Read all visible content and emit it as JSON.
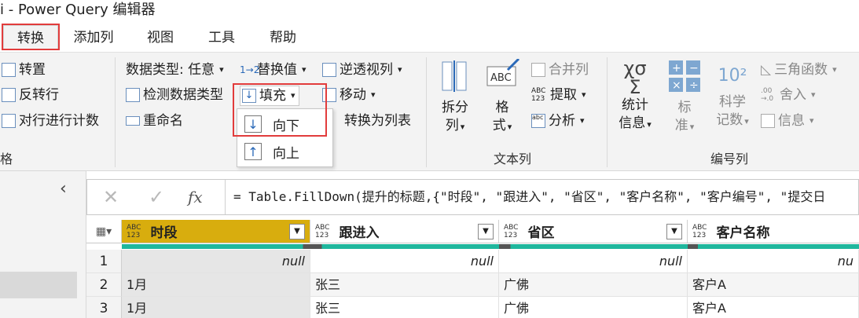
{
  "window": {
    "title": "i - Power Query 编辑器"
  },
  "tabs": [
    {
      "label": "转换",
      "active": true
    },
    {
      "label": "添加列"
    },
    {
      "label": "视图"
    },
    {
      "label": "工具"
    },
    {
      "label": "帮助"
    }
  ],
  "ribbon": {
    "table_group": {
      "transpose": "转置",
      "reverse_rows": "反转行",
      "count_rows": "对行进行计数",
      "label": "格"
    },
    "any_col_group": {
      "data_type": "数据类型: 任意",
      "detect_type": "检测数据类型",
      "rename": "重命名",
      "replace_values": "替换值",
      "fill": "填充",
      "unpivot": "逆透视列",
      "move": "移动",
      "convert_to_list": "转换为列表"
    },
    "text_group": {
      "split_column": [
        "拆分",
        "列"
      ],
      "format": [
        "格",
        "式"
      ],
      "merge_columns": "合并列",
      "extract": "提取",
      "parse": "分析",
      "label": "文本列"
    },
    "number_group": {
      "statistics": [
        "统计",
        "信息"
      ],
      "standard": [
        "标",
        "准"
      ],
      "scientific": [
        "科学",
        "记数"
      ],
      "trigonometry": "三角函数",
      "rounding": "舍入",
      "information": "信息",
      "label": "编号列"
    }
  },
  "fill_menu": {
    "down": "向下",
    "up": "向上"
  },
  "formula_bar": {
    "fx": "fx",
    "formula": "= Table.FillDown(提升的标题,{\"时段\", \"跟进入\", \"省区\", \"客户名称\", \"客户编号\", \"提交日"
  },
  "grid": {
    "type_badge": [
      "ABC",
      "123"
    ],
    "columns": [
      {
        "name": "时段",
        "selected": true
      },
      {
        "name": "跟进入"
      },
      {
        "name": "省区"
      },
      {
        "name": "客户名称"
      }
    ],
    "rows": [
      {
        "num": "1",
        "cells": [
          "null",
          "null",
          "null",
          "nu"
        ]
      },
      {
        "num": "2",
        "cells": [
          "1月",
          "张三",
          "广佛",
          "客户A"
        ]
      },
      {
        "num": "3",
        "cells": [
          "1月",
          "张三",
          "广佛",
          "客户A"
        ]
      }
    ]
  },
  "colors": {
    "accent_red": "#e23c3c",
    "selected_header": "#d8ad0e",
    "quality_bar": "#1fb79d"
  }
}
